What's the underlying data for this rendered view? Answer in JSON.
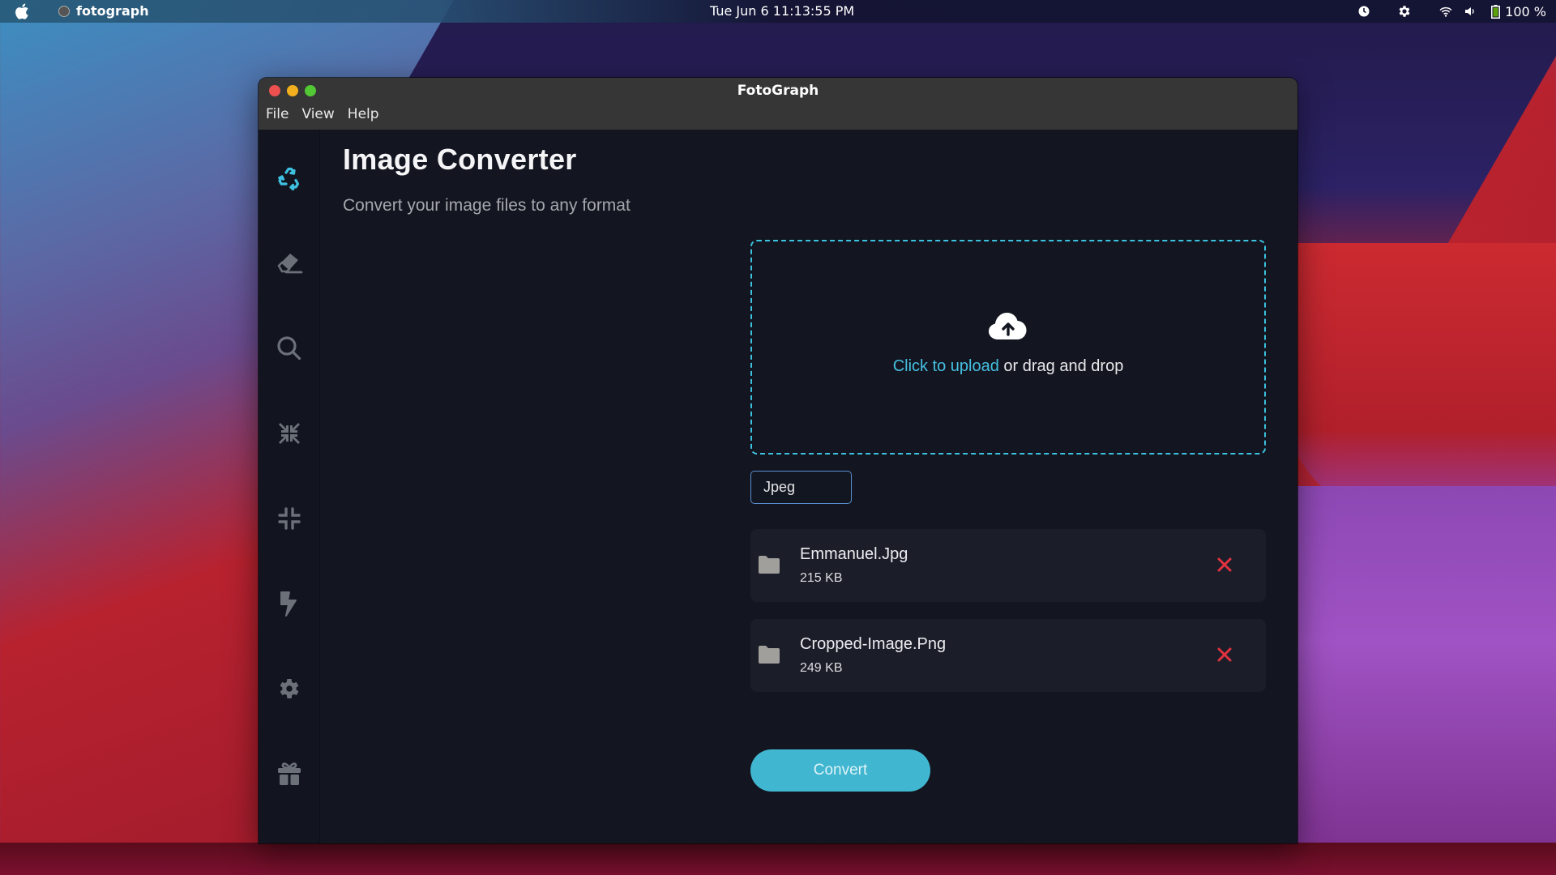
{
  "menubar": {
    "app_name": "fotograph",
    "clock": "Tue Jun 6  11:13:55 PM",
    "battery": "100 %",
    "icons": [
      "apple-icon",
      "app-icon",
      "clock-icon",
      "settings-icon",
      "wifi-icon",
      "volume-icon",
      "battery-icon"
    ]
  },
  "window": {
    "title": "FotoGraph",
    "menu": [
      "File",
      "View",
      "Help"
    ]
  },
  "sidebar": {
    "items": [
      {
        "name": "convert",
        "icon": "recycle-icon",
        "active": true
      },
      {
        "name": "eraser",
        "icon": "eraser-icon",
        "active": false
      },
      {
        "name": "search",
        "icon": "search-icon",
        "active": false
      },
      {
        "name": "compress",
        "icon": "compress-arrows-icon",
        "active": false
      },
      {
        "name": "minimize",
        "icon": "minimize-icon",
        "active": false
      },
      {
        "name": "enhance",
        "icon": "bolt-icon",
        "active": false
      },
      {
        "name": "settings",
        "icon": "gear-icon",
        "active": false
      },
      {
        "name": "gift",
        "icon": "gift-icon",
        "active": false
      }
    ]
  },
  "main": {
    "title": "Image Converter",
    "subtitle": "Convert your image files to any format",
    "dropzone": {
      "link_text": "Click to upload",
      "rest_text": " or drag and drop",
      "icon": "cloud-upload-icon"
    },
    "format_select": {
      "value": "Jpeg"
    },
    "files": [
      {
        "name": "Emmanuel.Jpg",
        "size": "215 KB"
      },
      {
        "name": "Cropped-Image.Png",
        "size": "249 KB"
      }
    ],
    "convert_label": "Convert"
  },
  "colors": {
    "accent": "#41b6d0",
    "remove": "#e0323f",
    "background": "#131620",
    "card": "#1b1e29"
  }
}
